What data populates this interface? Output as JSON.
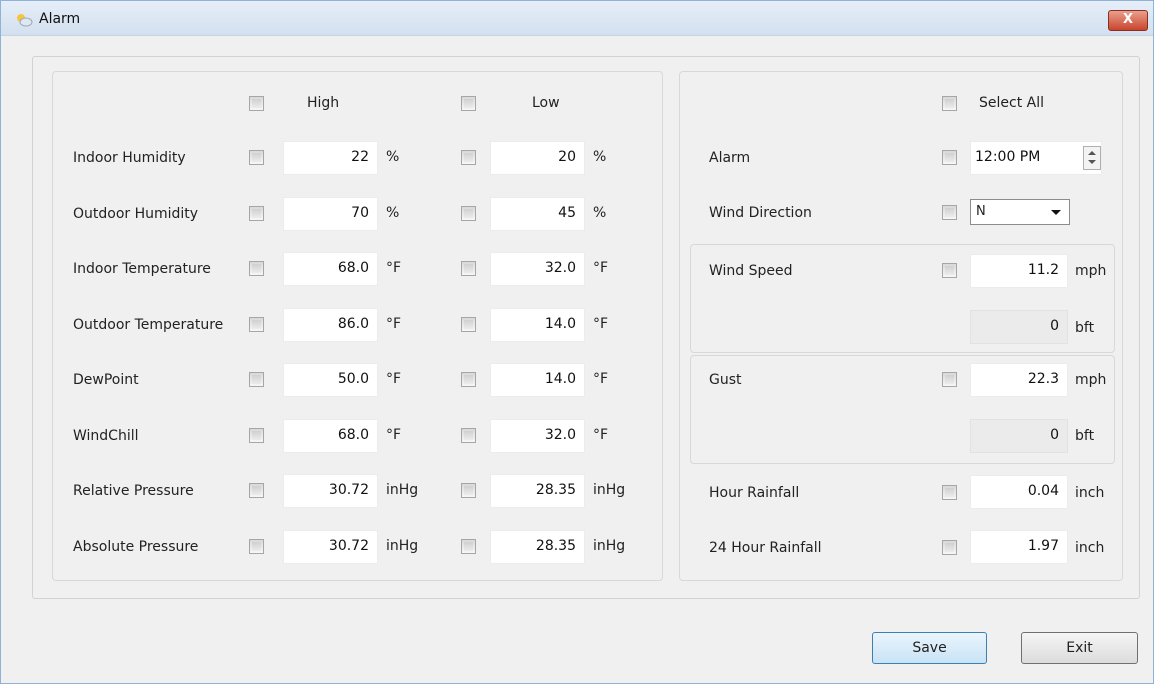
{
  "window": {
    "title": "Alarm",
    "close_label": "X"
  },
  "left": {
    "high_label": "High",
    "low_label": "Low",
    "rows": [
      {
        "label": "Indoor Humidity",
        "high": "22",
        "high_unit": "%",
        "low": "20",
        "low_unit": "%"
      },
      {
        "label": "Outdoor Humidity",
        "high": "70",
        "high_unit": "%",
        "low": "45",
        "low_unit": "%"
      },
      {
        "label": "Indoor Temperature",
        "high": "68.0",
        "high_unit": "°F",
        "low": "32.0",
        "low_unit": "°F"
      },
      {
        "label": "Outdoor Temperature",
        "high": "86.0",
        "high_unit": "°F",
        "low": "14.0",
        "low_unit": "°F"
      },
      {
        "label": "DewPoint",
        "high": "50.0",
        "high_unit": "°F",
        "low": "14.0",
        "low_unit": "°F"
      },
      {
        "label": "WindChill",
        "high": "68.0",
        "high_unit": "°F",
        "low": "32.0",
        "low_unit": "°F"
      },
      {
        "label": "Relative Pressure",
        "high": "30.72",
        "high_unit": "inHg",
        "low": "28.35",
        "low_unit": "inHg"
      },
      {
        "label": "Absolute Pressure",
        "high": "30.72",
        "high_unit": "inHg",
        "low": "28.35",
        "low_unit": "inHg"
      }
    ]
  },
  "right": {
    "select_all_label": "Select All",
    "alarm": {
      "label": "Alarm",
      "value": "12:00 PM"
    },
    "wind_direction": {
      "label": "Wind Direction",
      "value": "N"
    },
    "wind_speed": {
      "label": "Wind Speed",
      "value": "11.2",
      "unit": "mph",
      "bft_value": "0",
      "bft_unit": "bft"
    },
    "gust": {
      "label": "Gust",
      "value": "22.3",
      "unit": "mph",
      "bft_value": "0",
      "bft_unit": "bft"
    },
    "hour_rainfall": {
      "label": "Hour Rainfall",
      "value": "0.04",
      "unit": "inch"
    },
    "day_rainfall": {
      "label": "24 Hour Rainfall",
      "value": "1.97",
      "unit": "inch"
    }
  },
  "buttons": {
    "save": "Save",
    "exit": "Exit"
  },
  "icons": {
    "title": "weather-icon",
    "close": "close-icon",
    "dropdown": "chevron-down-icon"
  }
}
